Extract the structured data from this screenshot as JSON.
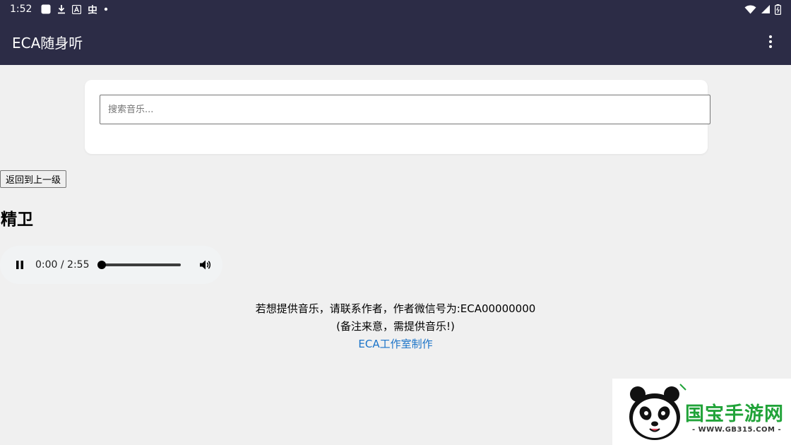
{
  "status_bar": {
    "time": "1:52"
  },
  "app_bar": {
    "title": "ECA随身听"
  },
  "search": {
    "placeholder": "搜索音乐..."
  },
  "navigation": {
    "back_label": "返回到上一级"
  },
  "song": {
    "title": "精卫"
  },
  "player": {
    "current_time": "0:00",
    "duration": "2:55",
    "time_text": "0:00 / 2:55",
    "progress": 0
  },
  "footer": {
    "line1": "若想提供音乐，请联系作者，作者微信号为:ECA00000000",
    "line2": "(备注来意，需提供音乐!)",
    "credit_link": "ECA工作室制作"
  },
  "watermark": {
    "brand": "国宝手游网",
    "url": "- WWW.GB315.COM -"
  },
  "colors": {
    "app_bar_bg": "#2c2c46",
    "page_bg": "#f0f0f0",
    "link": "#1a73c8",
    "watermark_green": "#21a339"
  }
}
